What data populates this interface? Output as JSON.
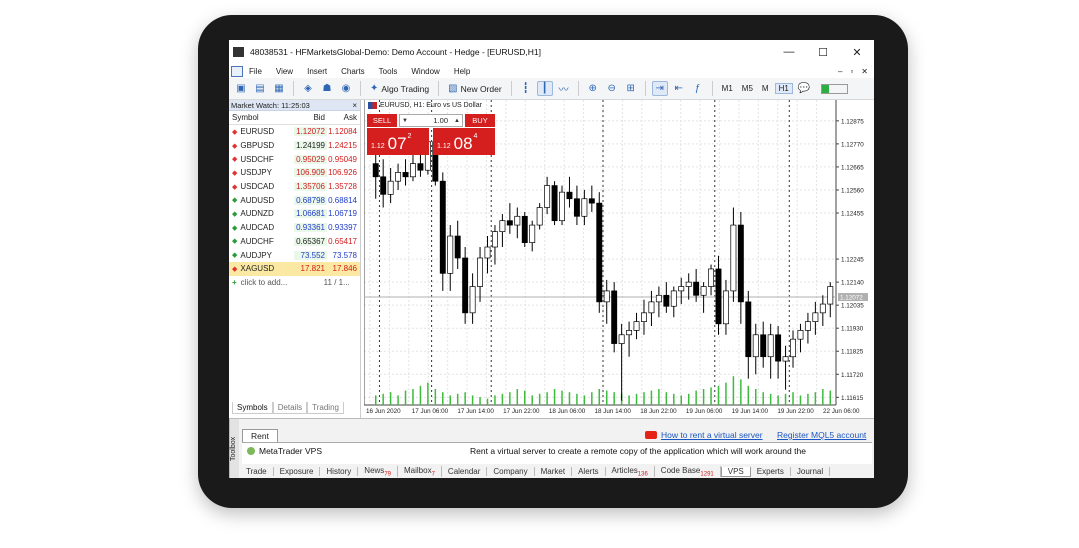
{
  "window": {
    "title": "48038531 - HFMarketsGlobal-Demo: Demo Account - Hedge - [EURUSD,H1]",
    "minimize": "—",
    "maximize": "☐",
    "close": "✕"
  },
  "menu": {
    "items": [
      "File",
      "View",
      "Insert",
      "Charts",
      "Tools",
      "Window",
      "Help"
    ],
    "mdi": [
      "–",
      "▫",
      "✕"
    ]
  },
  "toolbar": {
    "algo_trading": "Algo Trading",
    "new_order": "New Order",
    "timeframes": [
      "M1",
      "M5",
      "M",
      "H1"
    ],
    "active_timeframe": "H1"
  },
  "market_watch": {
    "header": "Market Watch: 11:25:03",
    "close": "×",
    "col_symbol": "Symbol",
    "col_bid": "Bid",
    "col_ask": "Ask",
    "rows": [
      {
        "symbol": "EURUSD",
        "bid": "1.12072",
        "ask": "1.12084",
        "dir": "dn",
        "bid_color": "red",
        "ask_color": "red"
      },
      {
        "symbol": "GBPUSD",
        "bid": "1.24199",
        "ask": "1.24215",
        "dir": "dn",
        "bid_color": "black",
        "ask_color": "red"
      },
      {
        "symbol": "USDCHF",
        "bid": "0.95029",
        "ask": "0.95049",
        "dir": "dn",
        "bid_color": "red",
        "ask_color": "red"
      },
      {
        "symbol": "USDJPY",
        "bid": "106.909",
        "ask": "106.926",
        "dir": "dn",
        "bid_color": "red",
        "ask_color": "red"
      },
      {
        "symbol": "USDCAD",
        "bid": "1.35706",
        "ask": "1.35728",
        "dir": "dn",
        "bid_color": "red",
        "ask_color": "red"
      },
      {
        "symbol": "AUDUSD",
        "bid": "0.68798",
        "ask": "0.68814",
        "dir": "up",
        "bid_color": "blue",
        "ask_color": "blue"
      },
      {
        "symbol": "AUDNZD",
        "bid": "1.06681",
        "ask": "1.06719",
        "dir": "up",
        "bid_color": "blue",
        "ask_color": "blue"
      },
      {
        "symbol": "AUDCAD",
        "bid": "0.93361",
        "ask": "0.93397",
        "dir": "up",
        "bid_color": "blue",
        "ask_color": "blue"
      },
      {
        "symbol": "AUDCHF",
        "bid": "0.65367",
        "ask": "0.65417",
        "dir": "up",
        "bid_color": "black",
        "ask_color": "red"
      },
      {
        "symbol": "AUDJPY",
        "bid": "73.552",
        "ask": "73.578",
        "dir": "up",
        "bid_color": "blue",
        "ask_color": "blue"
      },
      {
        "symbol": "XAGUSD",
        "bid": "17.821",
        "ask": "17.846",
        "dir": "dn",
        "bid_color": "red",
        "ask_color": "red"
      }
    ],
    "add_label": "click to add...",
    "count": "11 / 1...",
    "tabs": [
      "Symbols",
      "Details",
      "Trading"
    ]
  },
  "chart": {
    "label": "EURUSD, H1:  Euro vs US Dollar",
    "sell_label": "SELL",
    "buy_label": "BUY",
    "lot": "1.00",
    "sell_price": {
      "small": "1.12",
      "big": "07",
      "sup": "2"
    },
    "buy_price": {
      "small": "1.12",
      "big": "08",
      "sup": "4"
    },
    "current_price": "1.12072",
    "colors": {
      "volume": "#3dbb3d",
      "current": "#b0b0b0",
      "candle": "#000000"
    }
  },
  "chart_data": {
    "type": "candlestick",
    "symbol": "EURUSD",
    "timeframe": "H1",
    "ylim": [
      1.1158,
      1.1297
    ],
    "y_ticks": [
      "1.12875",
      "1.12770",
      "1.12665",
      "1.12560",
      "1.12455",
      "1.12245",
      "1.12140",
      "1.12035",
      "1.11930",
      "1.11825",
      "1.11720",
      "1.11615"
    ],
    "x_ticks": [
      "16 Jun 2020",
      "17 Jun 06:00",
      "17 Jun 14:00",
      "17 Jun 22:00",
      "18 Jun 06:00",
      "18 Jun 14:00",
      "18 Jun 22:00",
      "19 Jun 06:00",
      "19 Jun 14:00",
      "19 Jun 22:00",
      "22 Jun 06:00"
    ],
    "period_separators": [
      1,
      8,
      16,
      31,
      46,
      56
    ],
    "candles": [
      [
        1.1268,
        1.1274,
        1.1252,
        1.1262
      ],
      [
        1.1262,
        1.127,
        1.1248,
        1.1254
      ],
      [
        1.1254,
        1.1266,
        1.125,
        1.126
      ],
      [
        1.126,
        1.1268,
        1.1256,
        1.1264
      ],
      [
        1.1264,
        1.127,
        1.1258,
        1.1262
      ],
      [
        1.1262,
        1.1272,
        1.126,
        1.1268
      ],
      [
        1.1268,
        1.1275,
        1.1262,
        1.1265
      ],
      [
        1.1265,
        1.128,
        1.1263,
        1.1278
      ],
      [
        1.1278,
        1.1282,
        1.1258,
        1.126
      ],
      [
        1.126,
        1.1264,
        1.121,
        1.1218
      ],
      [
        1.1218,
        1.124,
        1.121,
        1.1235
      ],
      [
        1.1235,
        1.1242,
        1.122,
        1.1225
      ],
      [
        1.1225,
        1.123,
        1.1195,
        1.12
      ],
      [
        1.12,
        1.1218,
        1.1195,
        1.1212
      ],
      [
        1.1212,
        1.123,
        1.1205,
        1.1225
      ],
      [
        1.1225,
        1.1235,
        1.1218,
        1.123
      ],
      [
        1.123,
        1.124,
        1.1222,
        1.1237
      ],
      [
        1.1237,
        1.1245,
        1.123,
        1.1242
      ],
      [
        1.1242,
        1.125,
        1.1236,
        1.124
      ],
      [
        1.124,
        1.1248,
        1.1234,
        1.1244
      ],
      [
        1.1244,
        1.1246,
        1.123,
        1.1232
      ],
      [
        1.1232,
        1.1242,
        1.1228,
        1.124
      ],
      [
        1.124,
        1.125,
        1.1238,
        1.1248
      ],
      [
        1.1248,
        1.1262,
        1.1245,
        1.1258
      ],
      [
        1.1258,
        1.126,
        1.124,
        1.1242
      ],
      [
        1.1242,
        1.1258,
        1.124,
        1.1255
      ],
      [
        1.1255,
        1.1262,
        1.1248,
        1.1252
      ],
      [
        1.1252,
        1.1258,
        1.124,
        1.1244
      ],
      [
        1.1244,
        1.1256,
        1.124,
        1.1252
      ],
      [
        1.1252,
        1.1258,
        1.1246,
        1.125
      ],
      [
        1.125,
        1.1255,
        1.12,
        1.1205
      ],
      [
        1.1205,
        1.1215,
        1.1195,
        1.121
      ],
      [
        1.121,
        1.1214,
        1.1182,
        1.1186
      ],
      [
        1.1186,
        1.1195,
        1.116,
        1.119
      ],
      [
        1.119,
        1.1196,
        1.118,
        1.1192
      ],
      [
        1.1192,
        1.12,
        1.1188,
        1.1196
      ],
      [
        1.1196,
        1.1206,
        1.119,
        1.12
      ],
      [
        1.12,
        1.121,
        1.1194,
        1.1205
      ],
      [
        1.1205,
        1.1212,
        1.1198,
        1.1208
      ],
      [
        1.1208,
        1.1214,
        1.12,
        1.1203
      ],
      [
        1.1203,
        1.1212,
        1.1198,
        1.121
      ],
      [
        1.121,
        1.1216,
        1.1204,
        1.1212
      ],
      [
        1.1212,
        1.1218,
        1.1206,
        1.1214
      ],
      [
        1.1214,
        1.122,
        1.1205,
        1.1208
      ],
      [
        1.1208,
        1.1214,
        1.12,
        1.1212
      ],
      [
        1.1212,
        1.1222,
        1.1208,
        1.122
      ],
      [
        1.122,
        1.1226,
        1.119,
        1.1195
      ],
      [
        1.1195,
        1.1215,
        1.119,
        1.121
      ],
      [
        1.121,
        1.1248,
        1.1205,
        1.124
      ],
      [
        1.124,
        1.1246,
        1.1195,
        1.1205
      ],
      [
        1.1205,
        1.121,
        1.117,
        1.118
      ],
      [
        1.118,
        1.1195,
        1.1172,
        1.119
      ],
      [
        1.119,
        1.1196,
        1.1175,
        1.118
      ],
      [
        1.118,
        1.1195,
        1.117,
        1.119
      ],
      [
        1.119,
        1.1194,
        1.117,
        1.1178
      ],
      [
        1.1178,
        1.1185,
        1.1165,
        1.118
      ],
      [
        1.118,
        1.1192,
        1.1175,
        1.1188
      ],
      [
        1.1188,
        1.1195,
        1.1182,
        1.1192
      ],
      [
        1.1192,
        1.12,
        1.1186,
        1.1196
      ],
      [
        1.1196,
        1.1205,
        1.119,
        1.12
      ],
      [
        1.12,
        1.1208,
        1.1194,
        1.1204
      ],
      [
        1.1204,
        1.1214,
        1.1198,
        1.1212
      ]
    ],
    "volume_relative": [
      0.3,
      0.35,
      0.4,
      0.3,
      0.45,
      0.5,
      0.6,
      0.7,
      0.5,
      0.4,
      0.3,
      0.35,
      0.4,
      0.3,
      0.25,
      0.2,
      0.3,
      0.35,
      0.4,
      0.5,
      0.45,
      0.3,
      0.35,
      0.4,
      0.5,
      0.45,
      0.4,
      0.35,
      0.3,
      0.4,
      0.5,
      0.45,
      0.4,
      0.35,
      0.3,
      0.35,
      0.4,
      0.45,
      0.5,
      0.4,
      0.35,
      0.3,
      0.35,
      0.45,
      0.5,
      0.55,
      0.6,
      0.7,
      0.9,
      0.8,
      0.6,
      0.5,
      0.4,
      0.35,
      0.3,
      0.35,
      0.4,
      0.3,
      0.35,
      0.4,
      0.5,
      0.45
    ]
  },
  "toolbox": {
    "side_label": "Toolbox",
    "side_close": "×",
    "rent_tab": "Rent",
    "youtube_link": "How to rent a virtual server",
    "register_link": "Register MQL5 account",
    "vps_title": "MetaTrader VPS",
    "vps_text": "Rent a virtual server to create a remote copy of the application which will work around the",
    "tabs": [
      {
        "label": "Trade",
        "badge": ""
      },
      {
        "label": "Exposure",
        "badge": ""
      },
      {
        "label": "History",
        "badge": ""
      },
      {
        "label": "News",
        "badge": "79"
      },
      {
        "label": "Mailbox",
        "badge": "7"
      },
      {
        "label": "Calendar",
        "badge": ""
      },
      {
        "label": "Company",
        "badge": ""
      },
      {
        "label": "Market",
        "badge": ""
      },
      {
        "label": "Alerts",
        "badge": ""
      },
      {
        "label": "Articles",
        "badge": "136"
      },
      {
        "label": "Code Base",
        "badge": "1291"
      },
      {
        "label": "VPS",
        "badge": ""
      },
      {
        "label": "Experts",
        "badge": ""
      },
      {
        "label": "Journal",
        "badge": ""
      }
    ],
    "active_tab": "VPS"
  }
}
